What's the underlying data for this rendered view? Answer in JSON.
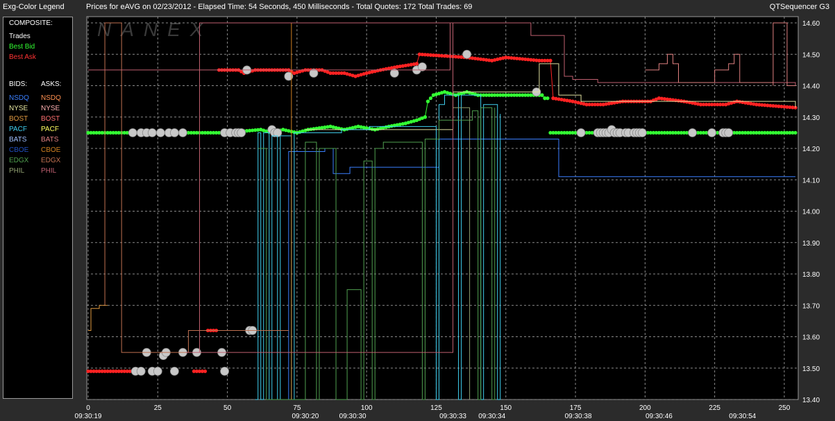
{
  "header": {
    "legend_title": "Exg-Color Legend",
    "chart_title": "Prices for  eAVG  on  02/23/2012  -  Elapsed Time: 54 Seconds, 450 Milliseconds  -  Total Quotes: 172  Total Trades: 69",
    "app_name": "QTSequencer G3"
  },
  "legend": {
    "composite_label": "COMPOSITE:",
    "composite": [
      {
        "label": "Trades",
        "color": "#ffffff"
      },
      {
        "label": "Best Bid",
        "color": "#33ff33"
      },
      {
        "label": "Best Ask",
        "color": "#ff3333"
      }
    ],
    "bids_label": "BIDS:",
    "asks_label": "ASKS:",
    "bids": [
      {
        "label": "NSDQ",
        "color": "#3a7fff"
      },
      {
        "label": "NYSE",
        "color": "#e6e6a0"
      },
      {
        "label": "BOST",
        "color": "#e09a40"
      },
      {
        "label": "PACF",
        "color": "#40d0f0"
      },
      {
        "label": "BATS",
        "color": "#a0c0ff"
      },
      {
        "label": "CBOE",
        "color": "#2050c0"
      },
      {
        "label": "EDGX",
        "color": "#50a050"
      },
      {
        "label": "PHIL",
        "color": "#90a070"
      }
    ],
    "asks": [
      {
        "label": "NSDQ",
        "color": "#ff9050"
      },
      {
        "label": "NYSE",
        "color": "#ffb0b0"
      },
      {
        "label": "BOST",
        "color": "#ff7070"
      },
      {
        "label": "PACF",
        "color": "#ffff60"
      },
      {
        "label": "BATS",
        "color": "#e08080"
      },
      {
        "label": "CBOE",
        "color": "#d08020"
      },
      {
        "label": "EDGX",
        "color": "#c07050"
      },
      {
        "label": "PHIL",
        "color": "#c06070"
      }
    ]
  },
  "watermark": "NANEX",
  "chart_data": {
    "type": "line",
    "x_ticks": [
      0,
      25,
      50,
      75,
      100,
      125,
      150,
      175,
      200,
      225,
      250
    ],
    "x_tick_labels": [
      "0",
      "25",
      "50",
      "75",
      "100",
      "125",
      "150",
      "175",
      "200",
      "225",
      "250"
    ],
    "time_labels": [
      {
        "x": 0,
        "label": "09:30:19"
      },
      {
        "x": 78,
        "label": "09:30:20"
      },
      {
        "x": 95,
        "label": "09:30:30"
      },
      {
        "x": 131,
        "label": "09:30:33"
      },
      {
        "x": 145,
        "label": "09:30:34"
      },
      {
        "x": 176,
        "label": "09:30:38"
      },
      {
        "x": 205,
        "label": "09:30:46"
      },
      {
        "x": 235,
        "label": "09:30:54"
      }
    ],
    "y_ticks": [
      13.4,
      13.5,
      13.6,
      13.7,
      13.8,
      13.9,
      14.0,
      14.1,
      14.2,
      14.3,
      14.4,
      14.5,
      14.6
    ],
    "y_tick_labels": [
      "13.40",
      "13.50",
      "13.60",
      "13.70",
      "13.80",
      "13.90",
      "14.00",
      "14.10",
      "14.20",
      "14.30",
      "14.40",
      "14.50",
      "14.60"
    ],
    "xlim": [
      -0.5,
      255
    ],
    "ylim": [
      13.4,
      14.62
    ],
    "grid": true,
    "series": [
      {
        "role": "best_bid_a",
        "color": "#33ff33",
        "dotted": true,
        "points": [
          [
            0,
            14.25
          ],
          [
            49,
            14.25
          ]
        ]
      },
      {
        "role": "best_bid_b",
        "color": "#33ff33",
        "dotted": true,
        "points": [
          [
            49,
            14.25
          ],
          [
            62,
            14.26
          ],
          [
            66,
            14.25
          ],
          [
            70,
            14.26
          ],
          [
            75,
            14.25
          ],
          [
            79,
            14.26
          ],
          [
            87,
            14.27
          ],
          [
            92,
            14.26
          ],
          [
            97,
            14.27
          ],
          [
            103,
            14.26
          ],
          [
            108,
            14.27
          ],
          [
            114,
            14.28
          ],
          [
            118,
            14.29
          ],
          [
            121,
            14.3
          ],
          [
            122,
            14.35
          ],
          [
            124,
            14.37
          ],
          [
            128,
            14.38
          ],
          [
            132,
            14.37
          ],
          [
            136,
            14.38
          ],
          [
            140,
            14.37
          ],
          [
            145,
            14.37
          ],
          [
            163,
            14.37
          ],
          [
            164,
            14.36
          ],
          [
            165,
            14.36
          ]
        ]
      },
      {
        "role": "best_bid_c",
        "color": "#33ff33",
        "dotted": true,
        "points": [
          [
            166,
            14.25
          ],
          [
            254,
            14.25
          ]
        ]
      },
      {
        "role": "best_ask_a",
        "color": "#ff2222",
        "dotted": true,
        "points": [
          [
            0,
            13.49
          ],
          [
            17,
            13.49
          ]
        ]
      },
      {
        "role": "best_ask_b",
        "color": "#ff2222",
        "dotted": true,
        "points": [
          [
            38,
            13.49
          ],
          [
            42,
            13.49
          ]
        ]
      },
      {
        "role": "best_ask_c",
        "color": "#ff2222",
        "dotted": true,
        "points": [
          [
            43,
            13.62
          ],
          [
            46,
            13.62
          ]
        ]
      },
      {
        "role": "best_ask_d",
        "color": "#ff2222",
        "dotted": true,
        "points": [
          [
            47,
            14.45
          ],
          [
            54,
            14.45
          ],
          [
            56,
            14.44
          ],
          [
            60,
            14.45
          ],
          [
            72,
            14.45
          ],
          [
            74,
            14.44
          ],
          [
            78,
            14.45
          ],
          [
            84,
            14.45
          ],
          [
            87,
            14.44
          ],
          [
            92,
            14.44
          ],
          [
            96,
            14.43
          ],
          [
            100,
            14.44
          ],
          [
            105,
            14.45
          ],
          [
            111,
            14.46
          ],
          [
            118,
            14.47
          ],
          [
            119,
            14.5
          ],
          [
            136,
            14.49
          ],
          [
            145,
            14.48
          ],
          [
            150,
            14.49
          ],
          [
            162,
            14.48
          ],
          [
            166,
            14.48
          ],
          [
            167,
            14.36
          ],
          [
            174,
            14.35
          ],
          [
            179,
            14.34
          ],
          [
            185,
            14.34
          ],
          [
            192,
            14.35
          ],
          [
            202,
            14.35
          ],
          [
            205,
            14.36
          ],
          [
            214,
            14.35
          ],
          [
            220,
            14.34
          ],
          [
            229,
            14.34
          ],
          [
            233,
            14.35
          ],
          [
            240,
            14.34
          ],
          [
            254,
            14.33
          ]
        ]
      },
      {
        "role": "trades",
        "color": "#cccccc",
        "marker": "circle",
        "points": [
          [
            17,
            13.49
          ],
          [
            19,
            13.49
          ],
          [
            21,
            13.55
          ],
          [
            23,
            13.49
          ],
          [
            25,
            13.49
          ],
          [
            27,
            13.54
          ],
          [
            28,
            13.55
          ],
          [
            31,
            13.49
          ],
          [
            34,
            13.55
          ],
          [
            39,
            13.55
          ],
          [
            48,
            13.55
          ],
          [
            49,
            13.49
          ],
          [
            58,
            13.62
          ],
          [
            59,
            13.62
          ],
          [
            16,
            14.25
          ],
          [
            19,
            14.25
          ],
          [
            21,
            14.25
          ],
          [
            23,
            14.25
          ],
          [
            26,
            14.25
          ],
          [
            29,
            14.25
          ],
          [
            31,
            14.25
          ],
          [
            34,
            14.25
          ],
          [
            49,
            14.25
          ],
          [
            51,
            14.25
          ],
          [
            53,
            14.25
          ],
          [
            54,
            14.25
          ],
          [
            55,
            14.25
          ],
          [
            66,
            14.26
          ],
          [
            67,
            14.25
          ],
          [
            68,
            14.25
          ],
          [
            72,
            14.43
          ],
          [
            57,
            14.45
          ],
          [
            81,
            14.44
          ],
          [
            110,
            14.44
          ],
          [
            118,
            14.45
          ],
          [
            120,
            14.46
          ],
          [
            136,
            14.5
          ],
          [
            161,
            14.38
          ],
          [
            177,
            14.25
          ],
          [
            183,
            14.25
          ],
          [
            184,
            14.25
          ],
          [
            185,
            14.25
          ],
          [
            186,
            14.25
          ],
          [
            187,
            14.25
          ],
          [
            188,
            14.26
          ],
          [
            189,
            14.25
          ],
          [
            190,
            14.25
          ],
          [
            191,
            14.25
          ],
          [
            193,
            14.25
          ],
          [
            194,
            14.25
          ],
          [
            196,
            14.25
          ],
          [
            197,
            14.25
          ],
          [
            198,
            14.25
          ],
          [
            199,
            14.25
          ],
          [
            217,
            14.25
          ],
          [
            224,
            14.25
          ],
          [
            228,
            14.25
          ],
          [
            229,
            14.25
          ],
          [
            230,
            14.25
          ]
        ]
      },
      {
        "role": "NSDQ bid",
        "color": "#3a7fff",
        "step": true,
        "points": [
          [
            71,
            13.4
          ],
          [
            72,
            14.19
          ],
          [
            85,
            14.2
          ],
          [
            88,
            14.12
          ],
          [
            94,
            14.14
          ],
          [
            125,
            14.14
          ],
          [
            126,
            14.23
          ],
          [
            168,
            14.23
          ],
          [
            169,
            14.11
          ],
          [
            254,
            14.11
          ]
        ]
      },
      {
        "role": "NYSE bid",
        "color": "#e0e0a0",
        "step": true,
        "points": [
          [
            78,
            14.26
          ],
          [
            130,
            14.26
          ],
          [
            131,
            14.38
          ],
          [
            150,
            14.38
          ],
          [
            161,
            14.38
          ],
          [
            162,
            14.47
          ],
          [
            168,
            14.47
          ],
          [
            169,
            14.37
          ],
          [
            176,
            14.37
          ],
          [
            177,
            14.35
          ],
          [
            254,
            14.33
          ]
        ]
      },
      {
        "role": "PACF bid",
        "color": "#40d0f0",
        "step": true,
        "points": [
          [
            60,
            13.4
          ],
          [
            61,
            14.25
          ],
          [
            62,
            13.4
          ],
          [
            63,
            14.25
          ],
          [
            65,
            13.4
          ],
          [
            66,
            14.24
          ],
          [
            68,
            13.4
          ],
          [
            69,
            14.24
          ],
          [
            73,
            13.4
          ],
          [
            74,
            14.25
          ],
          [
            90,
            14.25
          ],
          [
            91,
            14.26
          ],
          [
            100,
            14.26
          ],
          [
            101,
            14.27
          ],
          [
            124,
            14.27
          ],
          [
            125,
            13.4
          ],
          [
            126,
            14.34
          ],
          [
            128,
            14.37
          ],
          [
            130,
            14.37
          ],
          [
            133,
            13.4
          ],
          [
            134,
            14.37
          ],
          [
            141,
            13.4
          ],
          [
            142,
            14.34
          ],
          [
            147,
            13.4
          ],
          [
            148,
            14.31
          ]
        ]
      },
      {
        "role": "EDGX bid",
        "color": "#50a050",
        "step": true,
        "points": [
          [
            61,
            14.2
          ],
          [
            62,
            14.2
          ],
          [
            64,
            13.4
          ],
          [
            78,
            14.22
          ],
          [
            82,
            13.4
          ],
          [
            83,
            14.2
          ],
          [
            88,
            14.2
          ],
          [
            89,
            13.4
          ],
          [
            93,
            13.4
          ],
          [
            93,
            13.75
          ],
          [
            98,
            13.4
          ],
          [
            99,
            14.16
          ],
          [
            102,
            13.4
          ],
          [
            103,
            14.2
          ],
          [
            106,
            14.22
          ],
          [
            119,
            14.22
          ],
          [
            120,
            13.4
          ],
          [
            121,
            14.23
          ],
          [
            126,
            14.29
          ],
          [
            138,
            14.32
          ],
          [
            140,
            13.4
          ],
          [
            141,
            14.33
          ],
          [
            145,
            13.4
          ],
          [
            146,
            14.33
          ]
        ]
      },
      {
        "role": "PHIL bid",
        "color": "#90a070",
        "step": true,
        "points": [
          [
            131,
            14.33
          ],
          [
            136,
            14.33
          ],
          [
            137,
            13.4
          ]
        ]
      },
      {
        "role": "BOST ask",
        "color": "#e09a40",
        "step": true,
        "points": [
          [
            0,
            13.62
          ],
          [
            1,
            13.69
          ],
          [
            4,
            13.7
          ],
          [
            6,
            13.7
          ],
          [
            7,
            13.7
          ]
        ]
      },
      {
        "role": "CBOE ask",
        "color": "#d08020",
        "step": true,
        "points": [
          [
            73,
            14.6
          ],
          [
            73,
            13.4
          ]
        ]
      },
      {
        "role": "EDGX ask",
        "color": "#c07050",
        "step": true,
        "points": [
          [
            6,
            13.7
          ],
          [
            6,
            14.6
          ],
          [
            12,
            13.7
          ],
          [
            12,
            13.55
          ],
          [
            35,
            13.55
          ],
          [
            36,
            13.62
          ],
          [
            72,
            13.62
          ],
          [
            72,
            13.62
          ]
        ]
      },
      {
        "role": "PHIL ask",
        "color": "#c06070",
        "step": true,
        "points": [
          [
            0,
            14.45
          ],
          [
            80,
            14.45
          ],
          [
            130,
            14.45
          ],
          [
            130,
            14.6
          ],
          [
            131,
            13.55
          ],
          [
            35,
            13.55
          ],
          [
            40,
            13.55
          ],
          [
            40,
            14.6
          ],
          [
            159,
            14.6
          ],
          [
            159,
            14.56
          ],
          [
            171,
            14.56
          ],
          [
            171,
            14.43
          ],
          [
            174,
            14.42
          ],
          [
            183,
            14.41
          ],
          [
            198,
            14.41
          ],
          [
            254,
            14.4
          ]
        ]
      },
      {
        "role": "BATS ask",
        "color": "#e08080",
        "step": true,
        "points": [
          [
            200,
            14.45
          ],
          [
            205,
            14.47
          ],
          [
            208,
            14.5
          ],
          [
            210,
            14.47
          ],
          [
            212,
            14.41
          ],
          [
            225,
            14.45
          ],
          [
            230,
            14.47
          ],
          [
            232,
            14.5
          ],
          [
            234,
            14.41
          ],
          [
            246,
            14.4
          ],
          [
            246,
            14.6
          ],
          [
            251,
            14.6
          ],
          [
            251,
            14.4
          ],
          [
            254,
            14.4
          ]
        ]
      }
    ]
  }
}
